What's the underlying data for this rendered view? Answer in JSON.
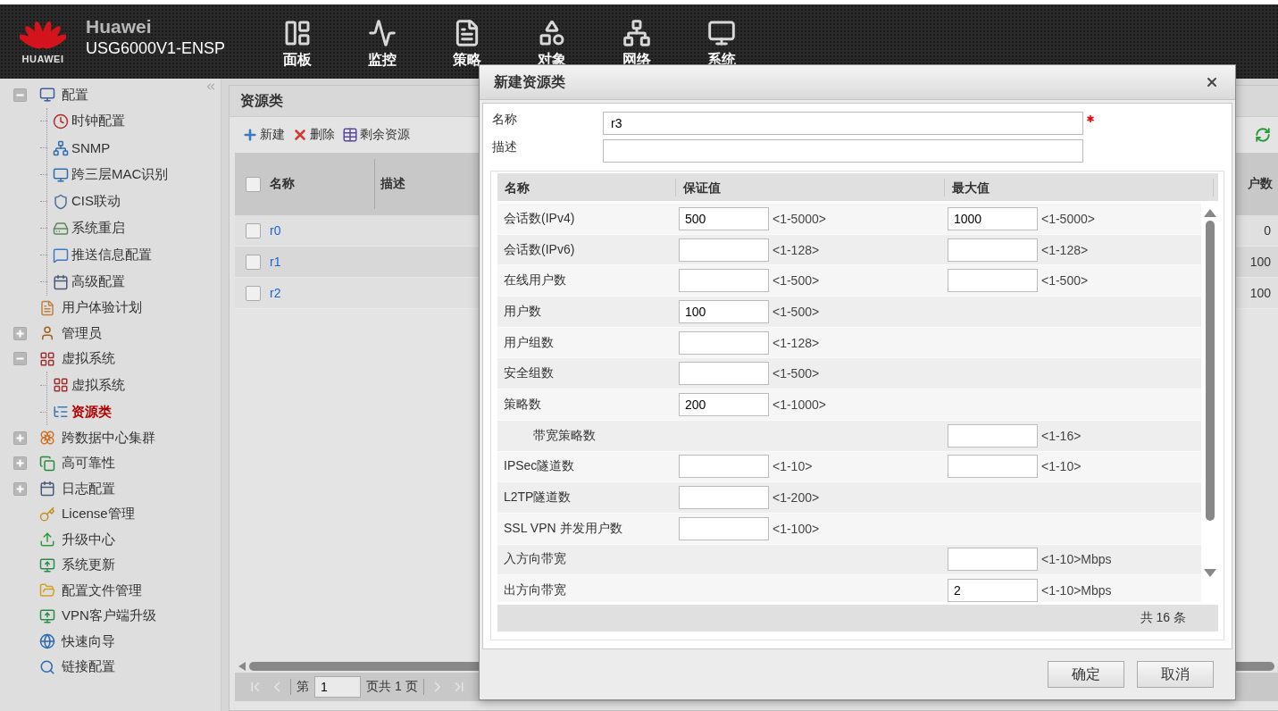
{
  "header": {
    "logo_text": "HUAWEI",
    "brand": "Huawei",
    "device": "USG6000V1-ENSP",
    "nav": [
      "面板",
      "监控",
      "策略",
      "对象",
      "网络",
      "系统"
    ]
  },
  "sidebar": {
    "items": [
      {
        "label": "配置",
        "selected": false,
        "expanded": true,
        "children": [
          {
            "label": "时钟配置",
            "selected": false
          },
          {
            "label": "SNMP",
            "selected": false
          },
          {
            "label": "跨三层MAC识别",
            "selected": false
          },
          {
            "label": "CIS联动",
            "selected": false
          },
          {
            "label": "系统重启",
            "selected": false
          },
          {
            "label": "推送信息配置",
            "selected": false
          },
          {
            "label": "高级配置",
            "selected": false
          }
        ]
      },
      {
        "label": "用户体验计划",
        "selected": false
      },
      {
        "label": "管理员",
        "selected": false,
        "expanded": false
      },
      {
        "label": "虚拟系统",
        "selected": false,
        "expanded": true,
        "children": [
          {
            "label": "虚拟系统",
            "selected": false
          },
          {
            "label": "资源类",
            "selected": true
          }
        ]
      },
      {
        "label": "跨数据中心集群",
        "selected": false,
        "expanded": false
      },
      {
        "label": "高可靠性",
        "selected": false,
        "expanded": false
      },
      {
        "label": "日志配置",
        "selected": false,
        "expanded": false
      },
      {
        "label": "License管理",
        "selected": false
      },
      {
        "label": "升级中心",
        "selected": false
      },
      {
        "label": "系统更新",
        "selected": false
      },
      {
        "label": "配置文件管理",
        "selected": false
      },
      {
        "label": "VPN客户端升级",
        "selected": false
      },
      {
        "label": "快速向导",
        "selected": false
      },
      {
        "label": "链接配置",
        "selected": false
      }
    ]
  },
  "main": {
    "title": "资源类",
    "toolbar": [
      "新建",
      "删除",
      "剩余资源"
    ],
    "table": {
      "columns": [
        "名称",
        "描述",
        "户数"
      ],
      "header_checked": false,
      "rows": [
        {
          "name": "r0",
          "value": "0",
          "checked": false
        },
        {
          "name": "r1",
          "value": "100",
          "checked": false
        },
        {
          "name": "r2",
          "value": "100",
          "checked": false
        }
      ]
    },
    "pager": {
      "prefix": "第",
      "page": "1",
      "suffix": "页共 1 页"
    }
  },
  "dialog": {
    "title": "新建资源类",
    "fields": [
      {
        "label": "名称",
        "value": "r3",
        "required": true
      },
      {
        "label": "描述"
      }
    ],
    "grid": {
      "columns": [
        "名称",
        "保证值",
        "最大值"
      ],
      "rows": [
        {
          "name": "会话数(IPv4)",
          "guarantee": {
            "value": "500",
            "range": "<1-5000>"
          },
          "maximum": {
            "value": "1000",
            "range": "<1-5000>"
          }
        },
        {
          "name": "会话数(IPv6)",
          "guarantee": {
            "range": "<1-128>"
          },
          "maximum": {
            "range": "<1-128>"
          }
        },
        {
          "name": "在线用户数",
          "guarantee": {
            "range": "<1-500>"
          },
          "maximum": {
            "range": "<1-500>"
          }
        },
        {
          "name": "用户数",
          "guarantee": {
            "value": "100",
            "range": "<1-500>"
          }
        },
        {
          "name": "用户组数",
          "guarantee": {
            "range": "<1-128>"
          }
        },
        {
          "name": "安全组数",
          "guarantee": {
            "range": "<1-500>"
          }
        },
        {
          "name": "策略数",
          "guarantee": {
            "value": "200",
            "range": "<1-1000>"
          },
          "children": [
            {
              "name": "带宽策略数",
              "maximum": {
                "range": "<1-16>"
              }
            }
          ]
        },
        {
          "name": "IPSec隧道数",
          "guarantee": {
            "range": "<1-10>"
          },
          "maximum": {
            "range": "<1-10>"
          }
        },
        {
          "name": "L2TP隧道数",
          "guarantee": {
            "range": "<1-200>"
          }
        },
        {
          "name": "SSL VPN 并发用户数",
          "guarantee": {
            "range": "<1-100>"
          }
        },
        {
          "name": "入方向带宽",
          "maximum": {
            "range": "<1-10>Mbps"
          }
        },
        {
          "name": "出方向带宽",
          "maximum": {
            "value": "2",
            "range": "<1-10>Mbps"
          }
        }
      ],
      "footer": "共 16 条"
    },
    "buttons": [
      "确定",
      "取消"
    ]
  }
}
